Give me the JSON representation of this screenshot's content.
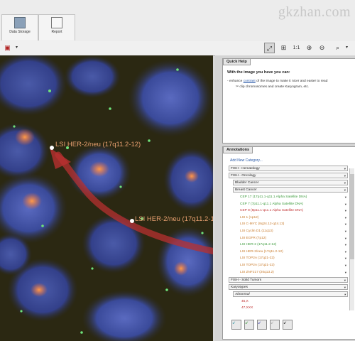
{
  "ribbon": {
    "buttons": [
      {
        "label": "Data Storage",
        "icon": "data-storage-icon"
      },
      {
        "label": "Report",
        "icon": "report-icon"
      }
    ],
    "watermark": "gkzhan.com"
  },
  "toolbar": {
    "left_icon": "save-icon",
    "tools": [
      "cursor-icon",
      "fit-icon",
      "1:1",
      "zoom-in-icon",
      "zoom-out-icon",
      "search-icon"
    ],
    "zoom_label": "1:1"
  },
  "viewport": {
    "labels": [
      {
        "text": "LSI HER-2/neu (17q11.2-12)"
      },
      {
        "text": "LSI HER-2/neu (17q11.2-12)"
      }
    ]
  },
  "quick_help": {
    "tab": "Quick Help",
    "title": "With the image you have you can:",
    "line1_prefix": "- enhance",
    "line1_link": "contrast",
    "line1_suffix": "of the image to make it nicer and easier to read",
    "line2": "clip chromosomes and create Karyogram, etc."
  },
  "annotations": {
    "tab": "Annotations",
    "add_category": "Add New Category...",
    "categories": [
      {
        "label": "FISH - Hematology"
      },
      {
        "label": "FISH - Oncology"
      },
      {
        "label": "Bladder Cancer"
      },
      {
        "label": "Breast Cancer"
      }
    ],
    "probes": [
      {
        "label": "CEP 17 (17p11.1-q11.1 Alpha Satellite DNA)",
        "color": "green"
      },
      {
        "label": "CEP 7 (7p11.1-q11.1 Alpha Satellite DNA)",
        "color": "green"
      },
      {
        "label": "CEP 8 (8p11.1-q11.1 Alpha Satellite DNA)",
        "color": "red"
      },
      {
        "label": "LSI 1 (1p12)",
        "color": "orange"
      },
      {
        "label": "LSI C-MYC (8q24.12-q24.13)",
        "color": "orange"
      },
      {
        "label": "LSI Cyclin D1 (11q13)",
        "color": "orange"
      },
      {
        "label": "LSI EGFR (7p12)",
        "color": "orange"
      },
      {
        "label": "LSI HER-2 (17q11.2-12)",
        "color": "green"
      },
      {
        "label": "LSI HER-2/neu (17q11.2-12)",
        "color": "orange"
      },
      {
        "label": "LSI TOP2A (17q21-22)",
        "color": "orange"
      },
      {
        "label": "LSI TOP2A (17q21-22)",
        "color": "orange"
      },
      {
        "label": "LSI ZNF217 (20q13.2)",
        "color": "orange"
      }
    ],
    "solid_tumors": "FISH - Solid Tumors",
    "karyotypes": "Karyotypes",
    "abnormal": "Abnormal",
    "karyo_items": [
      "45,X",
      "47,XXX"
    ],
    "colors": {
      "orange": "#c87a2a",
      "green": "#3a9a3a",
      "red": "#c03030",
      "link": "#2a5aa8"
    }
  }
}
